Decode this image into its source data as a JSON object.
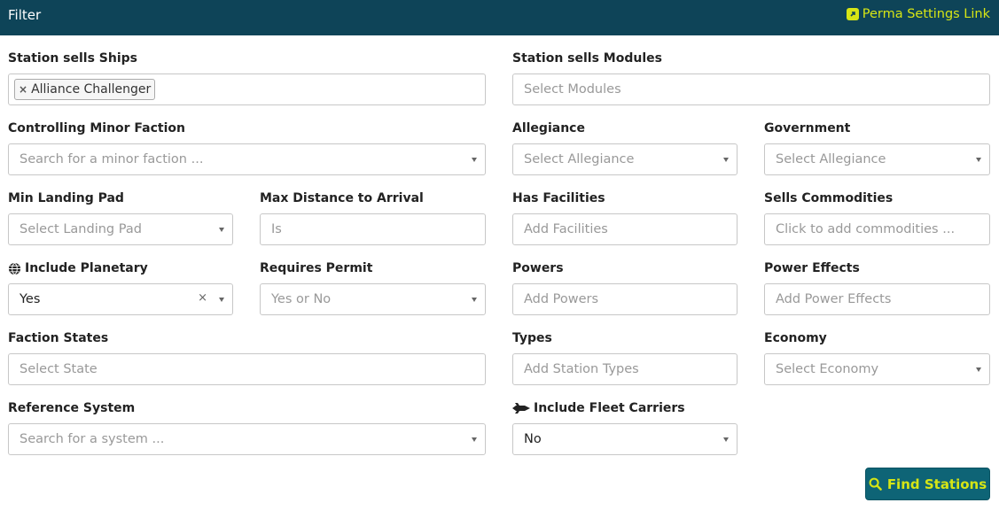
{
  "header": {
    "title": "Filter",
    "perma_link": "Perma Settings Link"
  },
  "fields": {
    "ships": {
      "label": "Station sells Ships",
      "tag": "Alliance Challenger"
    },
    "modules": {
      "label": "Station sells Modules",
      "placeholder": "Select Modules"
    },
    "minor_faction": {
      "label": "Controlling Minor Faction",
      "placeholder": "Search for a minor faction ..."
    },
    "allegiance": {
      "label": "Allegiance",
      "placeholder": "Select Allegiance"
    },
    "government": {
      "label": "Government",
      "placeholder": "Select Allegiance"
    },
    "landing_pad": {
      "label": "Min Landing Pad",
      "placeholder": "Select Landing Pad"
    },
    "max_distance": {
      "label": "Max Distance to Arrival",
      "placeholder": "Is"
    },
    "facilities": {
      "label": "Has Facilities",
      "placeholder": "Add Facilities"
    },
    "commodities": {
      "label": "Sells Commodities",
      "placeholder": "Click to add commodities ..."
    },
    "planetary": {
      "label": "Include Planetary",
      "value": "Yes"
    },
    "permit": {
      "label": "Requires Permit",
      "placeholder": "Yes or No"
    },
    "powers": {
      "label": "Powers",
      "placeholder": "Add Powers"
    },
    "power_effects": {
      "label": "Power Effects",
      "placeholder": "Add Power Effects"
    },
    "faction_states": {
      "label": "Faction States",
      "placeholder": "Select State"
    },
    "types": {
      "label": "Types",
      "placeholder": "Add Station Types"
    },
    "economy": {
      "label": "Economy",
      "placeholder": "Select Economy"
    },
    "reference_system": {
      "label": "Reference System",
      "placeholder": "Search for a system ..."
    },
    "fleet_carriers": {
      "label": "Include Fleet Carriers",
      "value": "No"
    }
  },
  "actions": {
    "find_stations": "Find Stations"
  },
  "colors": {
    "header_bg": "#0e4458",
    "accent": "#d6e515",
    "button_bg": "#0e6476"
  }
}
